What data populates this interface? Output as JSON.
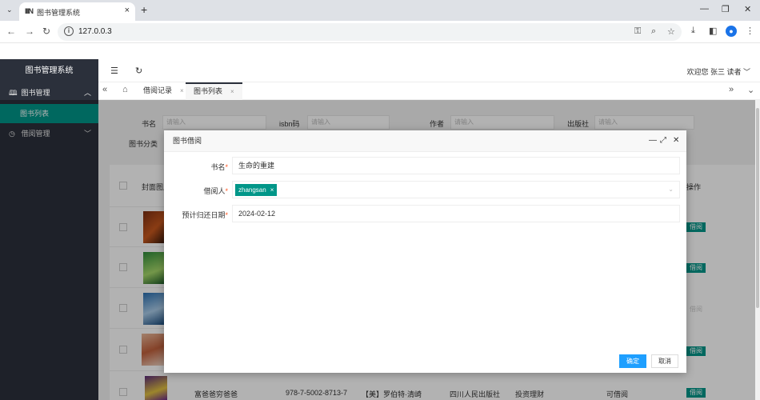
{
  "browser": {
    "tab_title": "图书管理系统",
    "favicon_text": "IIIN",
    "url": "127.0.0.3"
  },
  "app": {
    "brand": "图书管理系统",
    "welcome": "欢迎您 张三 读者 ﹀",
    "menu": [
      {
        "label": "图书管理",
        "arrow": "︿"
      },
      {
        "label": "借阅管理",
        "arrow": "﹀"
      }
    ],
    "submenu_active": "图书列表",
    "page_tabs": [
      {
        "label": "借阅记录"
      },
      {
        "label": "图书列表"
      }
    ],
    "search": {
      "labels": [
        "书名",
        "isbn码",
        "作者",
        "出版社",
        "图书分类"
      ],
      "placeholder": "请输入"
    },
    "table": {
      "headers": [
        "封面图片",
        "操作"
      ],
      "last_row": {
        "title": "富爸爸穷爸爸",
        "isbn": "978-7-5002-8713-7",
        "author": "【美】罗伯特·清崎",
        "publisher": "四川人民出版社",
        "category": "投资理财",
        "status": "可借阅"
      },
      "op_label": "借阅"
    }
  },
  "modal": {
    "title": "图书借阅",
    "fields": {
      "book_label": "书名",
      "book_value": "生命的重建",
      "borrower_label": "借阅人",
      "borrower_chip": "zhangsan",
      "return_label": "预计归还日期",
      "return_value": "2024-02-12"
    },
    "ok_label": "确定",
    "cancel_label": "取消"
  },
  "colors": {
    "primary": "#009688",
    "sidebar": "#2b303b",
    "ok_button": "#1e9fff",
    "required": "#ff5722"
  }
}
